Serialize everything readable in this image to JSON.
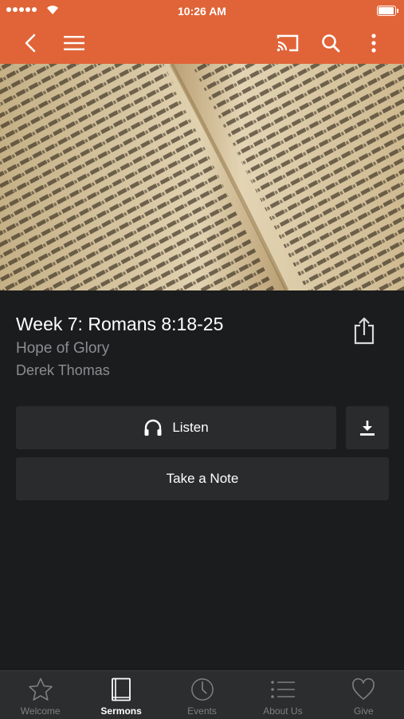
{
  "status_bar": {
    "time": "10:26 AM"
  },
  "icons": {
    "back": "back-chevron-icon",
    "menu": "hamburger-menu-icon",
    "cast": "cast-icon",
    "search": "search-icon",
    "more": "more-vertical-icon",
    "share": "share-icon",
    "headphones": "headphones-icon",
    "download": "download-icon"
  },
  "sermon": {
    "title": "Week 7: Romans 8:18-25",
    "series": "Hope of Glory",
    "speaker": "Derek Thomas"
  },
  "actions": {
    "listen_label": "Listen",
    "note_label": "Take a Note"
  },
  "tabs": [
    {
      "label": "Welcome",
      "icon": "star-icon",
      "active": false
    },
    {
      "label": "Sermons",
      "icon": "book-icon",
      "active": true
    },
    {
      "label": "Events",
      "icon": "clock-icon",
      "active": false
    },
    {
      "label": "About Us",
      "icon": "list-icon",
      "active": false
    },
    {
      "label": "Give",
      "icon": "heart-icon",
      "active": false
    }
  ],
  "colors": {
    "accent": "#e06438",
    "background": "#1b1c1e",
    "button": "#2a2b2d",
    "tab_bar": "#2c2d2f"
  }
}
